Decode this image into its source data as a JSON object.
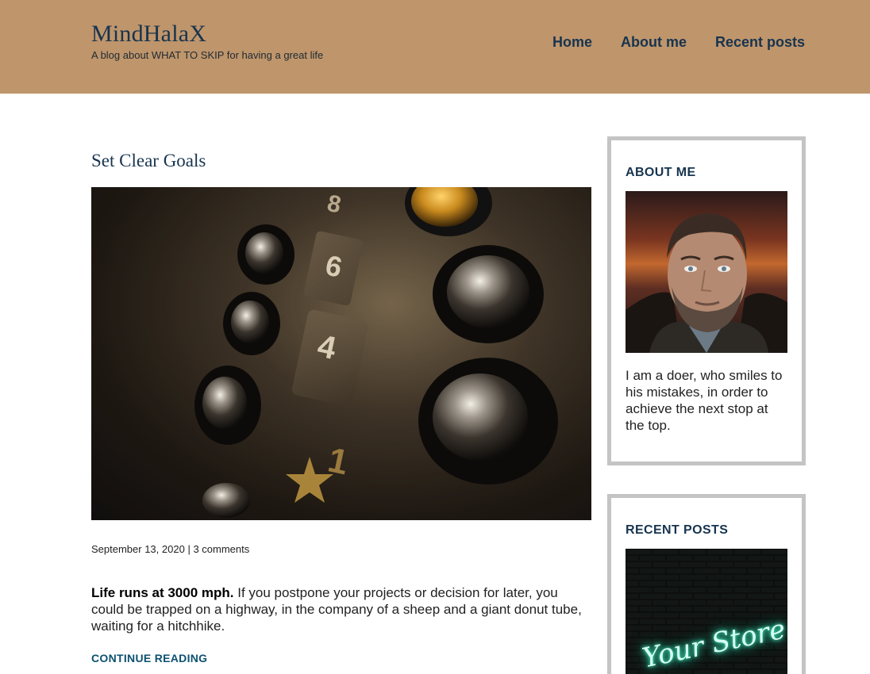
{
  "header": {
    "site_title": "MindHalaX",
    "tagline": "A blog about WHAT TO SKIP for having a great life",
    "nav": [
      "Home",
      "About me",
      "Recent posts"
    ]
  },
  "post": {
    "title": "Set Clear Goals",
    "image_alt": "Close-up of elevator buttons",
    "date": "September 13, 2020",
    "separator": "|",
    "comments": "3 comments",
    "excerpt_bold": "Life runs at 3000 mph.",
    "excerpt_rest": " If you postpone your projects or decision for later, you could be trapped on a highway, in the company of a sheep and a giant donut tube, waiting for a hitchhike.",
    "continue_label": "CONTINUE READING"
  },
  "sidebar": {
    "about": {
      "title": "ABOUT ME",
      "text": "I am a doer, who smiles to his mistakes, in order to achieve the next stop at the top."
    },
    "recent": {
      "title": "RECENT POSTS",
      "thumb_neon_text": "Your Store"
    }
  },
  "colors": {
    "header_bg": "#bf956b",
    "title_navy": "#17344f",
    "link_teal": "#0d5170",
    "widget_border": "#c4c4c4",
    "neon": "#3ff0c0"
  }
}
